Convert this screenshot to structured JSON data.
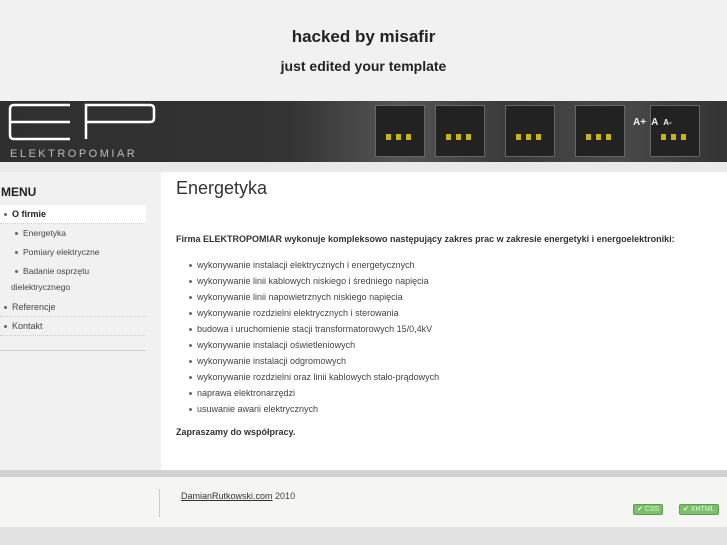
{
  "hack": {
    "line1": "hacked by misafir",
    "line2": "just edited your template"
  },
  "header": {
    "logo_text": "ELEKTROPOMIAR",
    "font_larger": "A+",
    "font_normal": "A",
    "font_smaller": "A-"
  },
  "sidebar": {
    "title": "MENU",
    "items": [
      {
        "label": "O firmie",
        "active": true
      },
      {
        "label": "Energetyka"
      },
      {
        "label": "Pomiary elektryczne"
      },
      {
        "label": "Badanie osprzętu"
      },
      {
        "label": "dielektrycznego"
      },
      {
        "label": "Referencje"
      },
      {
        "label": "Kontakt"
      }
    ]
  },
  "content": {
    "title": "Energetyka",
    "intro": "Firma ELEKTROPOMIAR wykonuje kompleksowo następujący zakres prac w zakresie energetyki i energoelektroniki:",
    "items": [
      "wykonywanie instalacji elektrycznych i energetycznych",
      "wykonywanie linii kablowych  niskiego i średniego napięcia",
      "wykonywanie linii napowietrznych niskiego napięcia",
      "wykonywanie rozdzielni elektrycznych i sterowania",
      "budowa i uruchomienie stacji transformatorowych 15/0,4kV",
      "wykonywanie instalacji oświetleniowych",
      "wykonywanie instalacji odgromowych",
      "wykonywanie rozdzielni oraz linii kablowych stało-prądowych",
      "naprawa elektronarzędzi",
      "usuwanie awarii elektrycznych"
    ],
    "outro": "Zapraszamy do współpracy."
  },
  "footer": {
    "link": "DamianRutkowski.com",
    "year": "2010",
    "badge_css": "CSS",
    "badge_xhtml": "XHTML"
  },
  "colors": {
    "badge": "#7cbf6a",
    "banner": "#333333"
  }
}
